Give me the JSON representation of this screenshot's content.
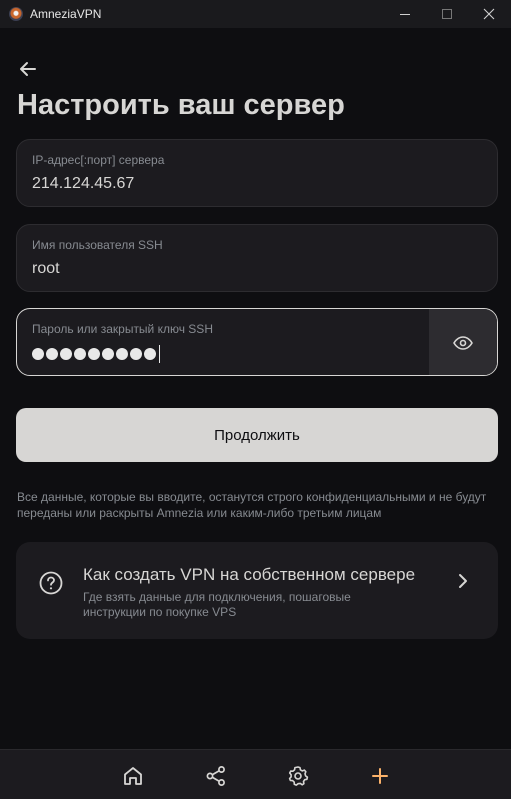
{
  "window": {
    "title": "AmneziaVPN"
  },
  "page": {
    "title": "Настроить ваш сервер"
  },
  "form": {
    "ip": {
      "label": "IP-адрес[:порт] сервера",
      "value": "214.124.45.67"
    },
    "user": {
      "label": "Имя пользователя SSH",
      "value": "root"
    },
    "password": {
      "label": "Пароль или закрытый ключ SSH",
      "masked_length": 9
    }
  },
  "continue_label": "Продолжить",
  "privacy_note": "Все данные, которые вы вводите, останутся строго конфиденциальными и не будут переданы или раскрыты Amnezia или каким-либо третьим лицам",
  "help": {
    "title": "Как создать VPN на собственном сервере",
    "description": "Где взять данные для подключения, пошаговые инструкции по покупке VPS"
  },
  "nav": {
    "items": [
      {
        "icon": "home-icon",
        "active": false
      },
      {
        "icon": "share-icon",
        "active": false
      },
      {
        "icon": "gear-icon",
        "active": false
      },
      {
        "icon": "plus-icon",
        "active": true
      }
    ]
  },
  "colors": {
    "background": "#0e0e11",
    "surface": "#1c1b1f",
    "text": "#d7d6d4",
    "muted": "#878b91",
    "accent": "#fbb26a"
  }
}
